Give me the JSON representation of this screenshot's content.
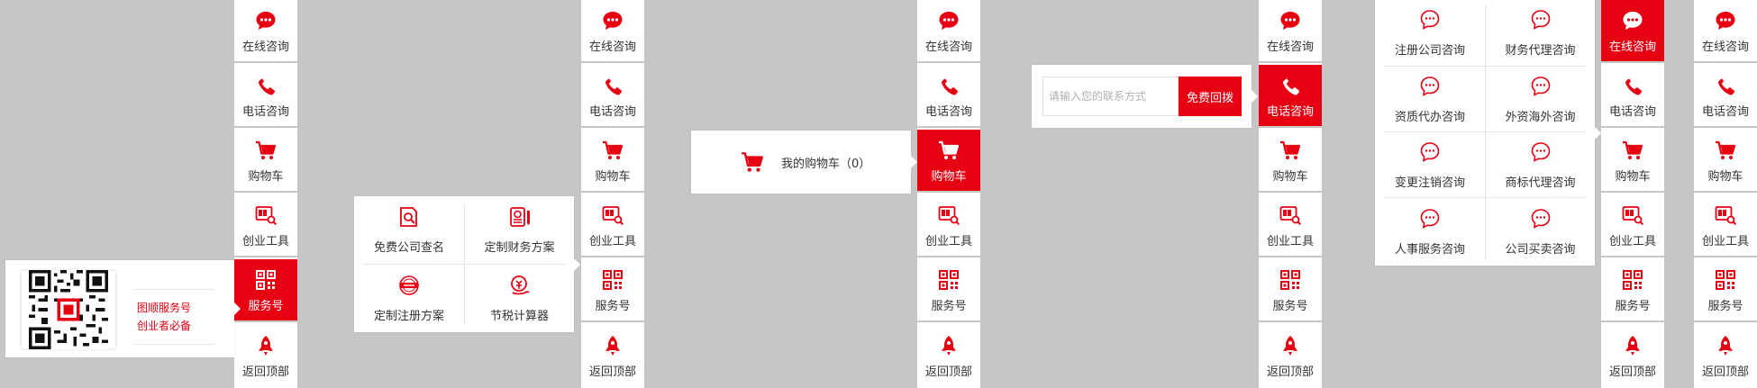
{
  "colors": {
    "accent": "#e60012",
    "background": "#c6c6c6",
    "text": "#333333"
  },
  "sidebar_labels": {
    "online": "在线咨询",
    "phone": "电话咨询",
    "cart": "购物车",
    "tools": "创业工具",
    "service": "服务号",
    "top": "返回顶部"
  },
  "sidebar_icons": [
    "chat-icon",
    "phone-icon",
    "cart-icon",
    "tools-icon",
    "qr-icon",
    "rocket-icon"
  ],
  "qr_popup": {
    "line1": "图顺服务号",
    "line2": "创业者必备"
  },
  "tools_popup": {
    "items": [
      {
        "label": "免费公司查名",
        "icon": "company-search-icon"
      },
      {
        "label": "定制财务方案",
        "icon": "finance-plan-icon"
      },
      {
        "label": "定制注册方案",
        "icon": "register-plan-icon"
      },
      {
        "label": "节税计算器",
        "icon": "tax-calculator-icon"
      }
    ]
  },
  "cart_popup": {
    "label": "我的购物车（0）"
  },
  "phone_popup": {
    "placeholder": "请输入您的联系方式",
    "button": "免费回拨"
  },
  "consult_popup": {
    "items": [
      {
        "label": "注册公司咨询"
      },
      {
        "label": "财务代理咨询"
      },
      {
        "label": "资质代办咨询"
      },
      {
        "label": "外资海外咨询"
      },
      {
        "label": "变更注销咨询"
      },
      {
        "label": "商标代理咨询"
      },
      {
        "label": "人事服务咨询"
      },
      {
        "label": "公司买卖咨询"
      }
    ]
  }
}
